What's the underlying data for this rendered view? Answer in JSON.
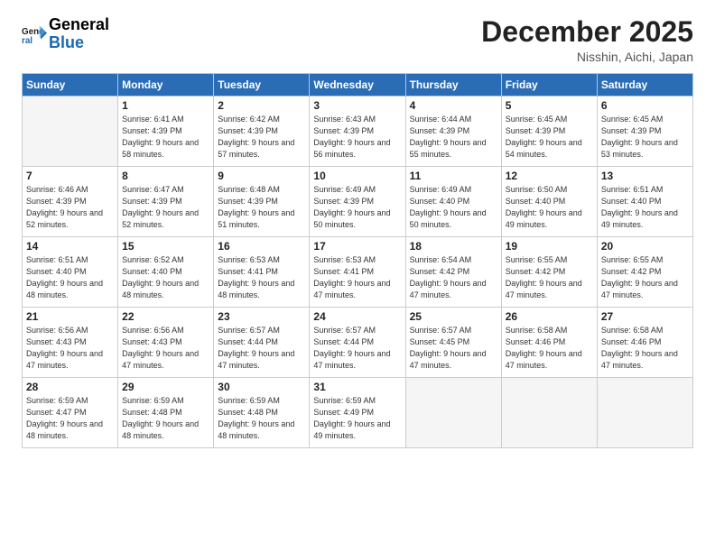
{
  "header": {
    "logo_general": "General",
    "logo_blue": "Blue",
    "month_title": "December 2025",
    "location": "Nisshin, Aichi, Japan"
  },
  "days_of_week": [
    "Sunday",
    "Monday",
    "Tuesday",
    "Wednesday",
    "Thursday",
    "Friday",
    "Saturday"
  ],
  "weeks": [
    [
      {
        "day": "",
        "empty": true
      },
      {
        "day": "1",
        "sunrise": "6:41 AM",
        "sunset": "4:39 PM",
        "daylight": "9 hours and 58 minutes."
      },
      {
        "day": "2",
        "sunrise": "6:42 AM",
        "sunset": "4:39 PM",
        "daylight": "9 hours and 57 minutes."
      },
      {
        "day": "3",
        "sunrise": "6:43 AM",
        "sunset": "4:39 PM",
        "daylight": "9 hours and 56 minutes."
      },
      {
        "day": "4",
        "sunrise": "6:44 AM",
        "sunset": "4:39 PM",
        "daylight": "9 hours and 55 minutes."
      },
      {
        "day": "5",
        "sunrise": "6:45 AM",
        "sunset": "4:39 PM",
        "daylight": "9 hours and 54 minutes."
      },
      {
        "day": "6",
        "sunrise": "6:45 AM",
        "sunset": "4:39 PM",
        "daylight": "9 hours and 53 minutes."
      }
    ],
    [
      {
        "day": "7",
        "sunrise": "6:46 AM",
        "sunset": "4:39 PM",
        "daylight": "9 hours and 52 minutes."
      },
      {
        "day": "8",
        "sunrise": "6:47 AM",
        "sunset": "4:39 PM",
        "daylight": "9 hours and 52 minutes."
      },
      {
        "day": "9",
        "sunrise": "6:48 AM",
        "sunset": "4:39 PM",
        "daylight": "9 hours and 51 minutes."
      },
      {
        "day": "10",
        "sunrise": "6:49 AM",
        "sunset": "4:39 PM",
        "daylight": "9 hours and 50 minutes."
      },
      {
        "day": "11",
        "sunrise": "6:49 AM",
        "sunset": "4:40 PM",
        "daylight": "9 hours and 50 minutes."
      },
      {
        "day": "12",
        "sunrise": "6:50 AM",
        "sunset": "4:40 PM",
        "daylight": "9 hours and 49 minutes."
      },
      {
        "day": "13",
        "sunrise": "6:51 AM",
        "sunset": "4:40 PM",
        "daylight": "9 hours and 49 minutes."
      }
    ],
    [
      {
        "day": "14",
        "sunrise": "6:51 AM",
        "sunset": "4:40 PM",
        "daylight": "9 hours and 48 minutes."
      },
      {
        "day": "15",
        "sunrise": "6:52 AM",
        "sunset": "4:40 PM",
        "daylight": "9 hours and 48 minutes."
      },
      {
        "day": "16",
        "sunrise": "6:53 AM",
        "sunset": "4:41 PM",
        "daylight": "9 hours and 48 minutes."
      },
      {
        "day": "17",
        "sunrise": "6:53 AM",
        "sunset": "4:41 PM",
        "daylight": "9 hours and 47 minutes."
      },
      {
        "day": "18",
        "sunrise": "6:54 AM",
        "sunset": "4:42 PM",
        "daylight": "9 hours and 47 minutes."
      },
      {
        "day": "19",
        "sunrise": "6:55 AM",
        "sunset": "4:42 PM",
        "daylight": "9 hours and 47 minutes."
      },
      {
        "day": "20",
        "sunrise": "6:55 AM",
        "sunset": "4:42 PM",
        "daylight": "9 hours and 47 minutes."
      }
    ],
    [
      {
        "day": "21",
        "sunrise": "6:56 AM",
        "sunset": "4:43 PM",
        "daylight": "9 hours and 47 minutes."
      },
      {
        "day": "22",
        "sunrise": "6:56 AM",
        "sunset": "4:43 PM",
        "daylight": "9 hours and 47 minutes."
      },
      {
        "day": "23",
        "sunrise": "6:57 AM",
        "sunset": "4:44 PM",
        "daylight": "9 hours and 47 minutes."
      },
      {
        "day": "24",
        "sunrise": "6:57 AM",
        "sunset": "4:44 PM",
        "daylight": "9 hours and 47 minutes."
      },
      {
        "day": "25",
        "sunrise": "6:57 AM",
        "sunset": "4:45 PM",
        "daylight": "9 hours and 47 minutes."
      },
      {
        "day": "26",
        "sunrise": "6:58 AM",
        "sunset": "4:46 PM",
        "daylight": "9 hours and 47 minutes."
      },
      {
        "day": "27",
        "sunrise": "6:58 AM",
        "sunset": "4:46 PM",
        "daylight": "9 hours and 47 minutes."
      }
    ],
    [
      {
        "day": "28",
        "sunrise": "6:59 AM",
        "sunset": "4:47 PM",
        "daylight": "9 hours and 48 minutes."
      },
      {
        "day": "29",
        "sunrise": "6:59 AM",
        "sunset": "4:48 PM",
        "daylight": "9 hours and 48 minutes."
      },
      {
        "day": "30",
        "sunrise": "6:59 AM",
        "sunset": "4:48 PM",
        "daylight": "9 hours and 48 minutes."
      },
      {
        "day": "31",
        "sunrise": "6:59 AM",
        "sunset": "4:49 PM",
        "daylight": "9 hours and 49 minutes."
      },
      {
        "day": "",
        "empty": true
      },
      {
        "day": "",
        "empty": true
      },
      {
        "day": "",
        "empty": true
      }
    ]
  ]
}
